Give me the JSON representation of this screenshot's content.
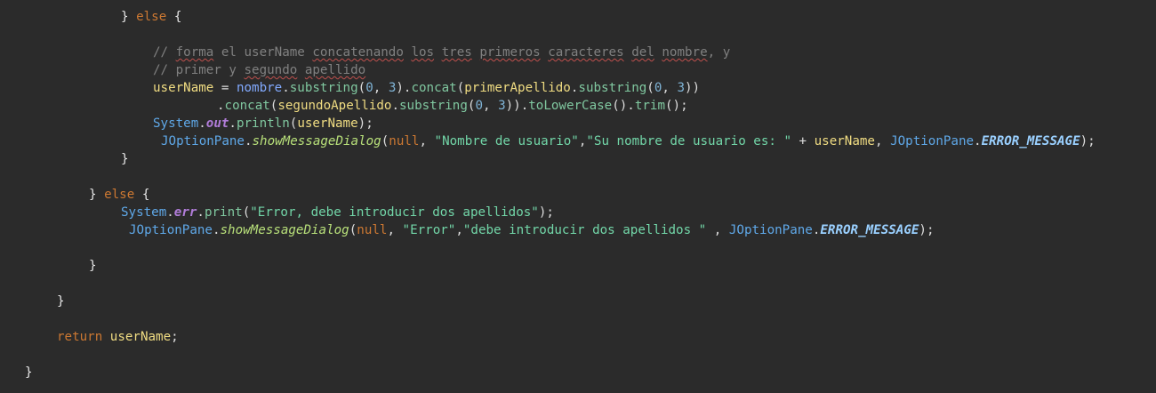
{
  "code": {
    "else_open": [
      "}",
      "else",
      "{"
    ],
    "comment1": [
      "// ",
      "forma",
      " el userName ",
      "concatenando",
      " ",
      "los",
      " ",
      "tres",
      " ",
      "primeros",
      " ",
      "caracteres",
      " ",
      "del",
      " ",
      "nombre",
      ", y"
    ],
    "comment2": [
      "// primer y ",
      "segundo",
      " ",
      "apellido"
    ],
    "assign": {
      "var": "userName",
      "op": " = ",
      "obj": "nombre",
      "m1": "substring",
      "n0": "0",
      "n3": "3",
      "m2": "concat",
      "arg": "primerApellido",
      "m3": "substring"
    },
    "concat2": {
      "m1": "concat",
      "arg": "segundoApellido",
      "m2": "substring",
      "n0": "0",
      "n3": "3",
      "m3": "toLowerCase",
      "m4": "trim"
    },
    "println": {
      "cls": "System",
      "fld": "out",
      "meth": "println",
      "arg": "userName"
    },
    "dialog1": {
      "cls": "JOptionPane",
      "meth": "showMessageDialog",
      "null_kw": "null",
      "s1": "\"Nombre de usuario\"",
      "s2": "\"Su nombre de usuario es: \"",
      "plus": " + ",
      "var": "userName",
      "cls2": "JOptionPane",
      "const": "ERROR_MESSAGE"
    },
    "close_brace": "}",
    "else_open2": [
      "}",
      "else",
      "{"
    ],
    "err": {
      "cls": "System",
      "fld": "err",
      "meth": "print",
      "s": "\"Error, debe introducir dos apellidos\""
    },
    "dialog2": {
      "cls": "JOptionPane",
      "meth": "showMessageDialog",
      "null_kw": "null",
      "s1": "\"Error\"",
      "s2": "\"debe introducir dos apellidos \"",
      "cls2": "JOptionPane",
      "const": "ERROR_MESSAGE"
    },
    "return_kw": "return",
    "return_var": "userName"
  }
}
